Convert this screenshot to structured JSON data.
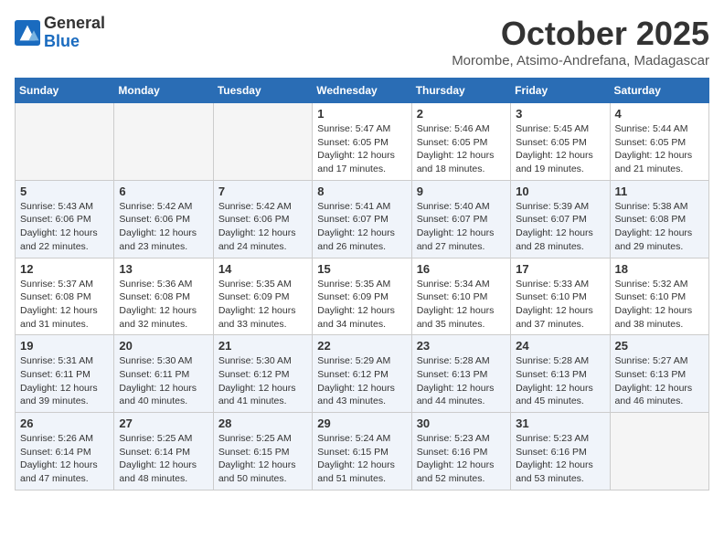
{
  "header": {
    "logo_general": "General",
    "logo_blue": "Blue",
    "month": "October 2025",
    "location": "Morombe, Atsimo-Andrefana, Madagascar"
  },
  "weekdays": [
    "Sunday",
    "Monday",
    "Tuesday",
    "Wednesday",
    "Thursday",
    "Friday",
    "Saturday"
  ],
  "weeks": [
    [
      {
        "day": "",
        "empty": true
      },
      {
        "day": "",
        "empty": true
      },
      {
        "day": "",
        "empty": true
      },
      {
        "day": "1",
        "sunrise": "5:47 AM",
        "sunset": "6:05 PM",
        "daylight": "12 hours and 17 minutes."
      },
      {
        "day": "2",
        "sunrise": "5:46 AM",
        "sunset": "6:05 PM",
        "daylight": "12 hours and 18 minutes."
      },
      {
        "day": "3",
        "sunrise": "5:45 AM",
        "sunset": "6:05 PM",
        "daylight": "12 hours and 19 minutes."
      },
      {
        "day": "4",
        "sunrise": "5:44 AM",
        "sunset": "6:05 PM",
        "daylight": "12 hours and 21 minutes."
      }
    ],
    [
      {
        "day": "5",
        "sunrise": "5:43 AM",
        "sunset": "6:06 PM",
        "daylight": "12 hours and 22 minutes."
      },
      {
        "day": "6",
        "sunrise": "5:42 AM",
        "sunset": "6:06 PM",
        "daylight": "12 hours and 23 minutes."
      },
      {
        "day": "7",
        "sunrise": "5:42 AM",
        "sunset": "6:06 PM",
        "daylight": "12 hours and 24 minutes."
      },
      {
        "day": "8",
        "sunrise": "5:41 AM",
        "sunset": "6:07 PM",
        "daylight": "12 hours and 26 minutes."
      },
      {
        "day": "9",
        "sunrise": "5:40 AM",
        "sunset": "6:07 PM",
        "daylight": "12 hours and 27 minutes."
      },
      {
        "day": "10",
        "sunrise": "5:39 AM",
        "sunset": "6:07 PM",
        "daylight": "12 hours and 28 minutes."
      },
      {
        "day": "11",
        "sunrise": "5:38 AM",
        "sunset": "6:08 PM",
        "daylight": "12 hours and 29 minutes."
      }
    ],
    [
      {
        "day": "12",
        "sunrise": "5:37 AM",
        "sunset": "6:08 PM",
        "daylight": "12 hours and 31 minutes."
      },
      {
        "day": "13",
        "sunrise": "5:36 AM",
        "sunset": "6:08 PM",
        "daylight": "12 hours and 32 minutes."
      },
      {
        "day": "14",
        "sunrise": "5:35 AM",
        "sunset": "6:09 PM",
        "daylight": "12 hours and 33 minutes."
      },
      {
        "day": "15",
        "sunrise": "5:35 AM",
        "sunset": "6:09 PM",
        "daylight": "12 hours and 34 minutes."
      },
      {
        "day": "16",
        "sunrise": "5:34 AM",
        "sunset": "6:10 PM",
        "daylight": "12 hours and 35 minutes."
      },
      {
        "day": "17",
        "sunrise": "5:33 AM",
        "sunset": "6:10 PM",
        "daylight": "12 hours and 37 minutes."
      },
      {
        "day": "18",
        "sunrise": "5:32 AM",
        "sunset": "6:10 PM",
        "daylight": "12 hours and 38 minutes."
      }
    ],
    [
      {
        "day": "19",
        "sunrise": "5:31 AM",
        "sunset": "6:11 PM",
        "daylight": "12 hours and 39 minutes."
      },
      {
        "day": "20",
        "sunrise": "5:30 AM",
        "sunset": "6:11 PM",
        "daylight": "12 hours and 40 minutes."
      },
      {
        "day": "21",
        "sunrise": "5:30 AM",
        "sunset": "6:12 PM",
        "daylight": "12 hours and 41 minutes."
      },
      {
        "day": "22",
        "sunrise": "5:29 AM",
        "sunset": "6:12 PM",
        "daylight": "12 hours and 43 minutes."
      },
      {
        "day": "23",
        "sunrise": "5:28 AM",
        "sunset": "6:13 PM",
        "daylight": "12 hours and 44 minutes."
      },
      {
        "day": "24",
        "sunrise": "5:28 AM",
        "sunset": "6:13 PM",
        "daylight": "12 hours and 45 minutes."
      },
      {
        "day": "25",
        "sunrise": "5:27 AM",
        "sunset": "6:13 PM",
        "daylight": "12 hours and 46 minutes."
      }
    ],
    [
      {
        "day": "26",
        "sunrise": "5:26 AM",
        "sunset": "6:14 PM",
        "daylight": "12 hours and 47 minutes."
      },
      {
        "day": "27",
        "sunrise": "5:25 AM",
        "sunset": "6:14 PM",
        "daylight": "12 hours and 48 minutes."
      },
      {
        "day": "28",
        "sunrise": "5:25 AM",
        "sunset": "6:15 PM",
        "daylight": "12 hours and 50 minutes."
      },
      {
        "day": "29",
        "sunrise": "5:24 AM",
        "sunset": "6:15 PM",
        "daylight": "12 hours and 51 minutes."
      },
      {
        "day": "30",
        "sunrise": "5:23 AM",
        "sunset": "6:16 PM",
        "daylight": "12 hours and 52 minutes."
      },
      {
        "day": "31",
        "sunrise": "5:23 AM",
        "sunset": "6:16 PM",
        "daylight": "12 hours and 53 minutes."
      },
      {
        "day": "",
        "empty": true
      }
    ]
  ]
}
